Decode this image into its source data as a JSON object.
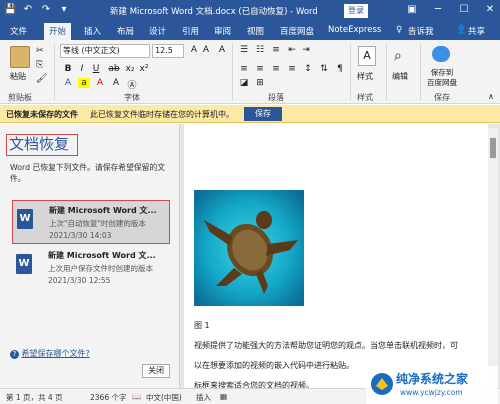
{
  "window": {
    "title": "新建 Microsoft Word 文档.docx (已自动恢复) - Word",
    "login_label": "登录"
  },
  "tabs": [
    "文件",
    "开始",
    "插入",
    "布局",
    "设计",
    "引用",
    "审阅",
    "视图",
    "百度网盘",
    "NoteExpress"
  ],
  "tell_me": "告诉我",
  "share": "共享",
  "ribbon": {
    "paste": "粘贴",
    "font_name": "等线 (中文正文)",
    "font_size": "12.5",
    "styles": "样式",
    "editing": "编辑",
    "save_baidu": "保存到\n百度网盘",
    "group_labels": [
      "剪贴板",
      "字体",
      "段落",
      "样式",
      "保存"
    ]
  },
  "message_bar": {
    "bold": "已恢复未保存的文件",
    "text": "此已恢复文件临时存储在您的计算机中。",
    "save_label": "保存"
  },
  "recovery": {
    "title": "文档恢复",
    "description": "Word 已恢复下列文件。请保存希望保留的文件。",
    "files": [
      {
        "name": "新建 Microsoft Word 文...",
        "status": "上次\"自动恢复\"时创建的版本",
        "date": "2021/3/30 14:03"
      },
      {
        "name": "新建 Microsoft Word 文...",
        "status": "上次用户保存文件时创建的版本",
        "date": "2021/3/30 12:55"
      }
    ],
    "help_link": "希望保存哪个文件?",
    "close_label": "关闭"
  },
  "document": {
    "caption": "图 1",
    "line1": "视频提供了功能强大的方法帮助您证明您的观点。当您单击联机视频时，可",
    "line2": "以在想要添加的视频的嵌入代码中进行粘贴。",
    "line3": "标框来搜索适合您的文档的视频。"
  },
  "status_bar": {
    "page": "第 1 页，共 4 页",
    "words": "2366 个字",
    "lang": "中文(中国)",
    "mode": "插入"
  },
  "watermark": {
    "title": "纯净系统之家",
    "url": "www.ycwjzy.com"
  },
  "colors": {
    "accent": "#2b579a",
    "highlight": "#d04a4a",
    "msgbar": "#fbe9a5"
  }
}
